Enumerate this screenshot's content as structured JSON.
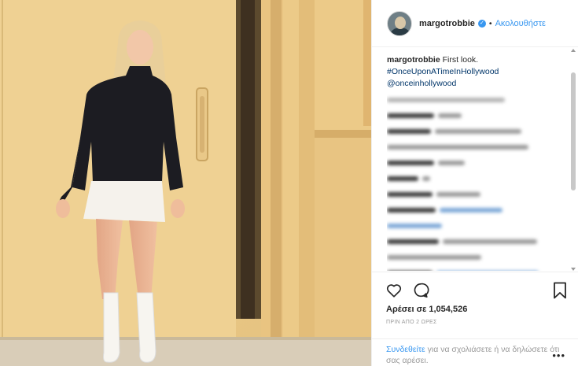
{
  "post": {
    "username": "margotrobbie",
    "verified_mark": "✓",
    "separator": "•",
    "follow_label": "Ακολουθήστε",
    "caption_user": "margotrobbie",
    "caption_text": "First look.",
    "hashtag": "#OnceUponATimeInHollywood",
    "mention": "@onceinhollywood",
    "likes": "Αρέσει σε 1,054,526",
    "time": "ΠΡΙΝ ΑΠΟ 2 ΩΡΕΣ",
    "login_link": "Συνδεθείτε",
    "login_text": "για να σχολιάσετε ή να δηλώσετε ότι σας αρέσει.",
    "more": "•••"
  },
  "icons": {
    "like": "heart-icon",
    "comment": "comment-icon",
    "save": "bookmark-icon",
    "more": "more-options-icon"
  },
  "colors": {
    "link": "#3897f0",
    "hashtag": "#003569",
    "wall": "#e8c887"
  }
}
